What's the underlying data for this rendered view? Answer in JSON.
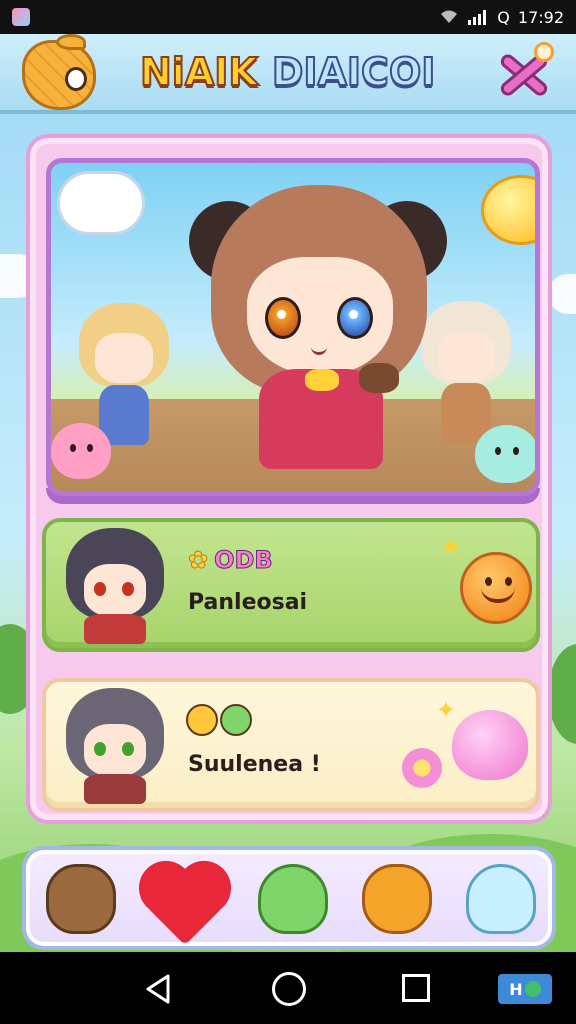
{
  "status_bar": {
    "time": "17:92",
    "signal_icon": "signal-icon",
    "wifi_icon": "wifi-icon",
    "battery_letter": "Q"
  },
  "header": {
    "title_part_1": "NiAIK",
    "title_part_2": "DIAICOI",
    "left_icon": "pineapple-icon",
    "right_icon": "close-icon"
  },
  "cards": [
    {
      "label": "ODB",
      "text": "Panleosai",
      "icon": "smiley-icon"
    },
    {
      "text": "Suulenea !",
      "icon": "pink-slime-icon"
    }
  ],
  "tray": {
    "items": [
      {
        "icon": "bear-icon"
      },
      {
        "icon": "heart-icon"
      },
      {
        "icon": "green-slime-icon"
      },
      {
        "icon": "orange-bear-icon"
      },
      {
        "icon": "ghost-icon"
      }
    ]
  },
  "nav_bar": {
    "badge_text": "H"
  },
  "colors": {
    "title_a": "#ffcf2d",
    "title_b": "#bde4ff",
    "panel_bg": "#f7c9ec",
    "card_green": "#a8d46b",
    "card_cream": "#fbeec5"
  }
}
